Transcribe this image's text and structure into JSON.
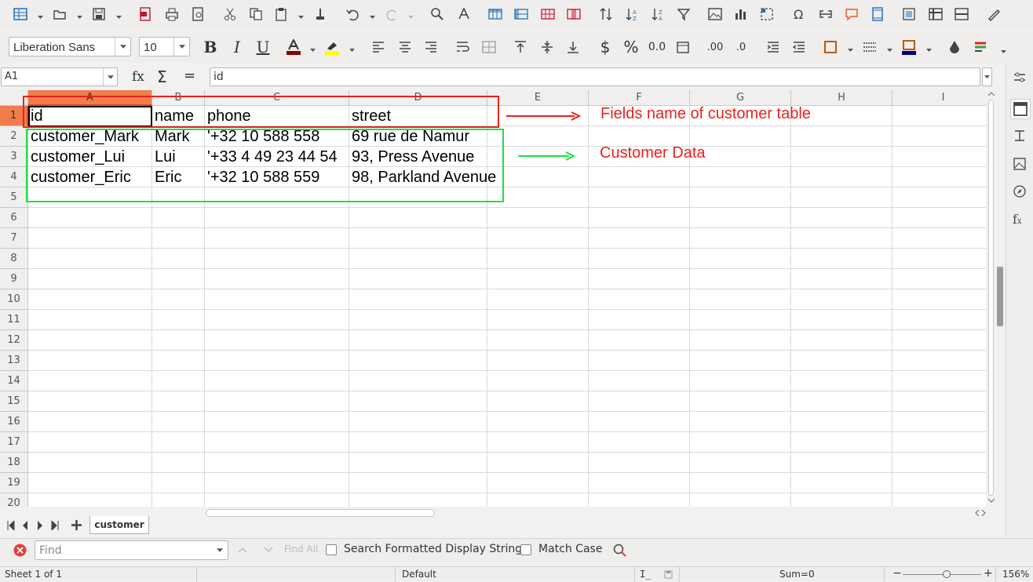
{
  "toolbar": {
    "icons": [
      "spreadsheet-icon",
      "open-icon",
      "save-icon",
      "export-pdf-icon",
      "print-icon",
      "print-preview-icon",
      "cut-icon",
      "copy-icon",
      "paste-icon",
      "clone-format-icon",
      "undo-icon",
      "redo-icon",
      "find-replace-icon",
      "spelling-icon",
      "row-icon",
      "column-icon",
      "insert-row-icon",
      "delete-row-icon",
      "sort-icon",
      "sort-ascending-icon",
      "sort-descending-icon",
      "autofilter-icon",
      "image-icon",
      "chart-icon",
      "pivot-table-icon",
      "special-character-icon",
      "hyperlink-icon",
      "comment-icon",
      "headers-footers-icon",
      "define-print-area-icon",
      "freeze-icon",
      "split-window-icon",
      "draw-icon"
    ]
  },
  "format": {
    "font_name": "Liberation Sans",
    "font_size": "10",
    "font_color": "#8b0000",
    "highlight_color": "#ffff00",
    "border_color": "#000080"
  },
  "formula": {
    "name_box": "A1",
    "fx": "fx",
    "sum": "Σ",
    "equals": "=",
    "content": "id"
  },
  "columns": [
    "A",
    "B",
    "C",
    "D",
    "E",
    "F",
    "G",
    "H",
    "I"
  ],
  "rows": [
    "1",
    "2",
    "3",
    "4",
    "5",
    "6",
    "7",
    "8",
    "9",
    "10",
    "11",
    "12",
    "13",
    "14",
    "15",
    "16",
    "17",
    "18",
    "19",
    "20"
  ],
  "cells": [
    [
      "id",
      "name",
      "phone",
      "street"
    ],
    [
      "customer_Mark",
      "Mark",
      "'+32 10 588 558",
      "69 rue de Namur"
    ],
    [
      "customer_Lui",
      "Lui",
      "'+33 4 49 23 44 54",
      "93, Press Avenue"
    ],
    [
      "customer_Eric",
      "Eric",
      "'+32 10 588 559",
      "98, Parkland Avenue"
    ]
  ],
  "annotations": {
    "fields_label": "Fields name of customer table",
    "data_label": "Customer Data",
    "red": "#e8221c",
    "green": "#22dd44"
  },
  "sheet_tab": "customer",
  "find": {
    "placeholder": "Find",
    "find_all": "Find All",
    "formatted": "Search Formatted Display String",
    "match_case": "Match Case"
  },
  "status": {
    "sheet": "Sheet 1 of 1",
    "style": "Default",
    "sum": "Sum=0",
    "zoom": "156%"
  }
}
